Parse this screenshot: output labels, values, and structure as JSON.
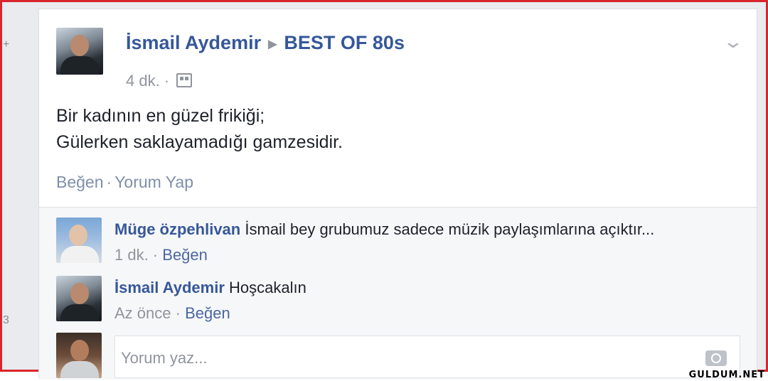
{
  "side_marks": {
    "top": "+",
    "bottom": "3"
  },
  "post": {
    "author": "İsmail Aydemir",
    "group": "BEST OF 80s",
    "time": "4 dk. ·",
    "text_line1": "Bir kadının en güzel frikiği;",
    "text_line2": "Gülerken saklayamadığı gamzesidir.",
    "like_label": "Beğen",
    "separator": "·",
    "comment_label": "Yorum Yap"
  },
  "comments": [
    {
      "name": "Müge özpehlivan",
      "text": "İsmail bey grubumuz sadece müzik paylaşımlarına açıktır...",
      "time": "1 dk. ·",
      "like": "Beğen"
    },
    {
      "name": "İsmail Aydemir",
      "text": "Hoşcakalın",
      "time": "Az önce ·",
      "like": "Beğen"
    }
  ],
  "composer": {
    "placeholder": "Yorum yaz..."
  },
  "watermark": "GULDUM.NET",
  "colors": {
    "link": "#365899",
    "meta": "#90949c",
    "border": "#d8262c"
  }
}
